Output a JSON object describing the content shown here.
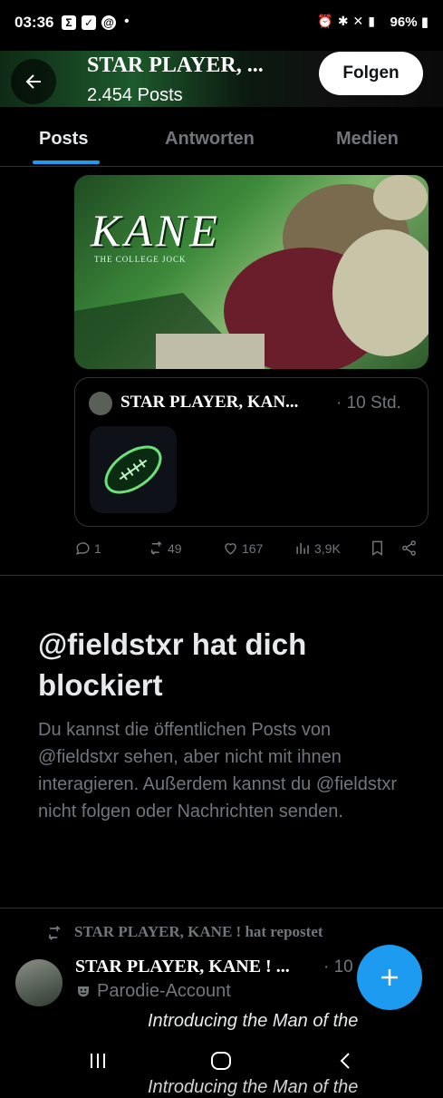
{
  "status_bar": {
    "time": "03:36",
    "battery": "96%",
    "dot": "•"
  },
  "header": {
    "title": "STAR PLAYER, ...",
    "post_count": "2.454 Posts",
    "follow_label": "Folgen"
  },
  "tabs": [
    {
      "label": "Posts",
      "active": true
    },
    {
      "label": "Antworten",
      "active": false
    },
    {
      "label": "Medien",
      "active": false
    }
  ],
  "banner": {
    "title": "KANE",
    "subtitle": "THE COLLEGE JOCK"
  },
  "quote": {
    "author": "STAR PLAYER, KAN...",
    "time": "· 10 Std."
  },
  "actions": {
    "replies": "1",
    "reposts": "49",
    "likes": "167",
    "views": "3,9K"
  },
  "blocked": {
    "title": "@fieldstxr hat dich blockiert",
    "body": "Du kannst die öffentlichen Posts von @fieldstxr sehen, aber nicht mit ihnen interagieren. Außerdem kannst du @fieldstxr nicht folgen oder Nachrichten senden."
  },
  "repost": {
    "line": "STAR PLAYER, KANE ! hat repostet",
    "author": "STAR PLAYER, KANE ! ...",
    "time": "· 10",
    "badge": "Parodie-Account",
    "text": "Introducing the Man of the"
  },
  "colors": {
    "accent": "#1d9bf0",
    "background": "#000000",
    "muted": "#71767b",
    "divider": "#2f3336"
  }
}
